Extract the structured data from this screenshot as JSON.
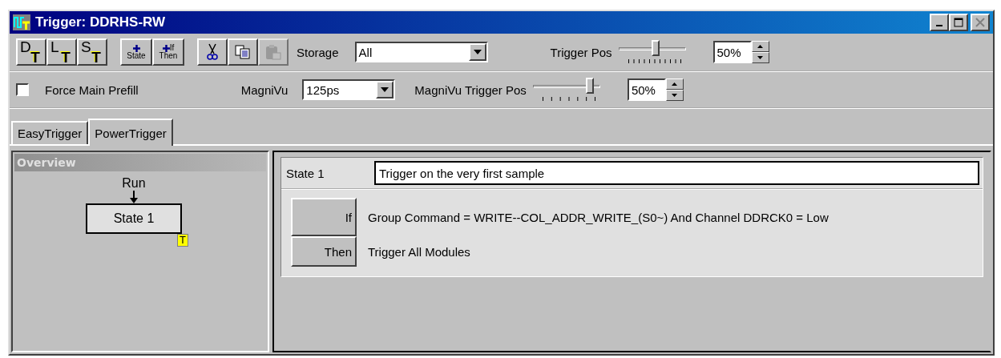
{
  "window": {
    "title": "Trigger: DDRHS-RW",
    "controls": [
      {
        "kind": "minimize",
        "disabled": false
      },
      {
        "kind": "maximize",
        "disabled": false
      },
      {
        "kind": "close",
        "disabled": true
      }
    ]
  },
  "toolbar": {
    "trigger_buttons": [
      {
        "letter": "D",
        "sub": "T"
      },
      {
        "letter": "L",
        "sub": "T"
      },
      {
        "letter": "S",
        "sub": "T"
      }
    ],
    "add_buttons": [
      {
        "lines": [
          "State"
        ]
      },
      {
        "lines": [
          "If",
          "Then"
        ]
      }
    ],
    "edit_buttons": [
      {
        "kind": "cut",
        "disabled": false
      },
      {
        "kind": "copy",
        "disabled": false
      },
      {
        "kind": "paste",
        "disabled": true
      }
    ],
    "storage": {
      "label": "Storage",
      "value": "All"
    },
    "trigger_pos": {
      "label": "Trigger Pos",
      "level": 0.55,
      "value": "50%"
    }
  },
  "options": {
    "force_main_prefill": {
      "label": "Force Main Prefill",
      "checked": false
    },
    "magnivu": {
      "label": "MagniVu",
      "value": "125ps"
    },
    "magnivu_trigger_pos": {
      "label": "MagniVu Trigger Pos",
      "level": 0.85,
      "value": "50%"
    }
  },
  "tabs": [
    {
      "label": "EasyTrigger",
      "selected": false
    },
    {
      "label": "PowerTrigger",
      "selected": true
    }
  ],
  "overview": {
    "title": "Overview",
    "start": "Run",
    "states": [
      {
        "label": "State 1",
        "badge": "T"
      }
    ]
  },
  "states": [
    {
      "name": "State 1",
      "description": "Trigger on the very first sample",
      "clauses": [
        {
          "kind": "if",
          "button": "If",
          "text": "Group Command = WRITE--COL_ADDR_WRITE_(S0~) And Channel DDRCK0 = Low"
        },
        {
          "kind": "then",
          "button": "Then",
          "text": "Trigger All Modules"
        }
      ]
    }
  ]
}
